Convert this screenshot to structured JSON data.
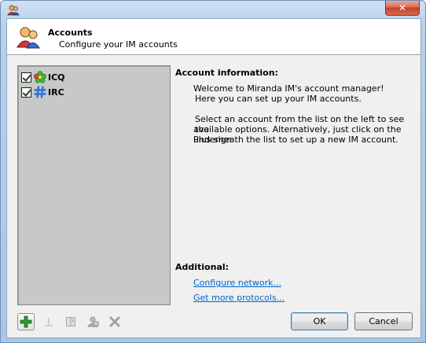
{
  "window": {
    "close_label": "✕"
  },
  "header": {
    "title": "Accounts",
    "subtitle": "Configure your IM accounts"
  },
  "accounts": [
    {
      "label": "ICQ",
      "checked": true,
      "icon": "flower-icon"
    },
    {
      "label": "IRC",
      "checked": true,
      "icon": "hash-icon"
    }
  ],
  "info": {
    "heading": "Account information:",
    "para1_line1": "Welcome to Miranda IM's account manager!",
    "para1_line2": "Here you can set up your IM accounts.",
    "para2_line1": "Select an account from the list on the left to see the",
    "para2_line2": "available options. Alternatively, just click on the Plus sign",
    "para2_line3": "underneath the list to set up a new IM account."
  },
  "additional": {
    "heading": "Additional:",
    "configure_network": "Configure network...",
    "more_protocols": "Get more protocols..."
  },
  "toolbar": {
    "icons": [
      "add-icon",
      "rename-icon",
      "options-icon",
      "upgrade-icon",
      "delete-icon"
    ]
  },
  "buttons": {
    "ok": "OK",
    "cancel": "Cancel"
  },
  "colors": {
    "link": "#0066cc",
    "list_bg": "#c8c8c8",
    "add_green": "#2e9b2e"
  }
}
